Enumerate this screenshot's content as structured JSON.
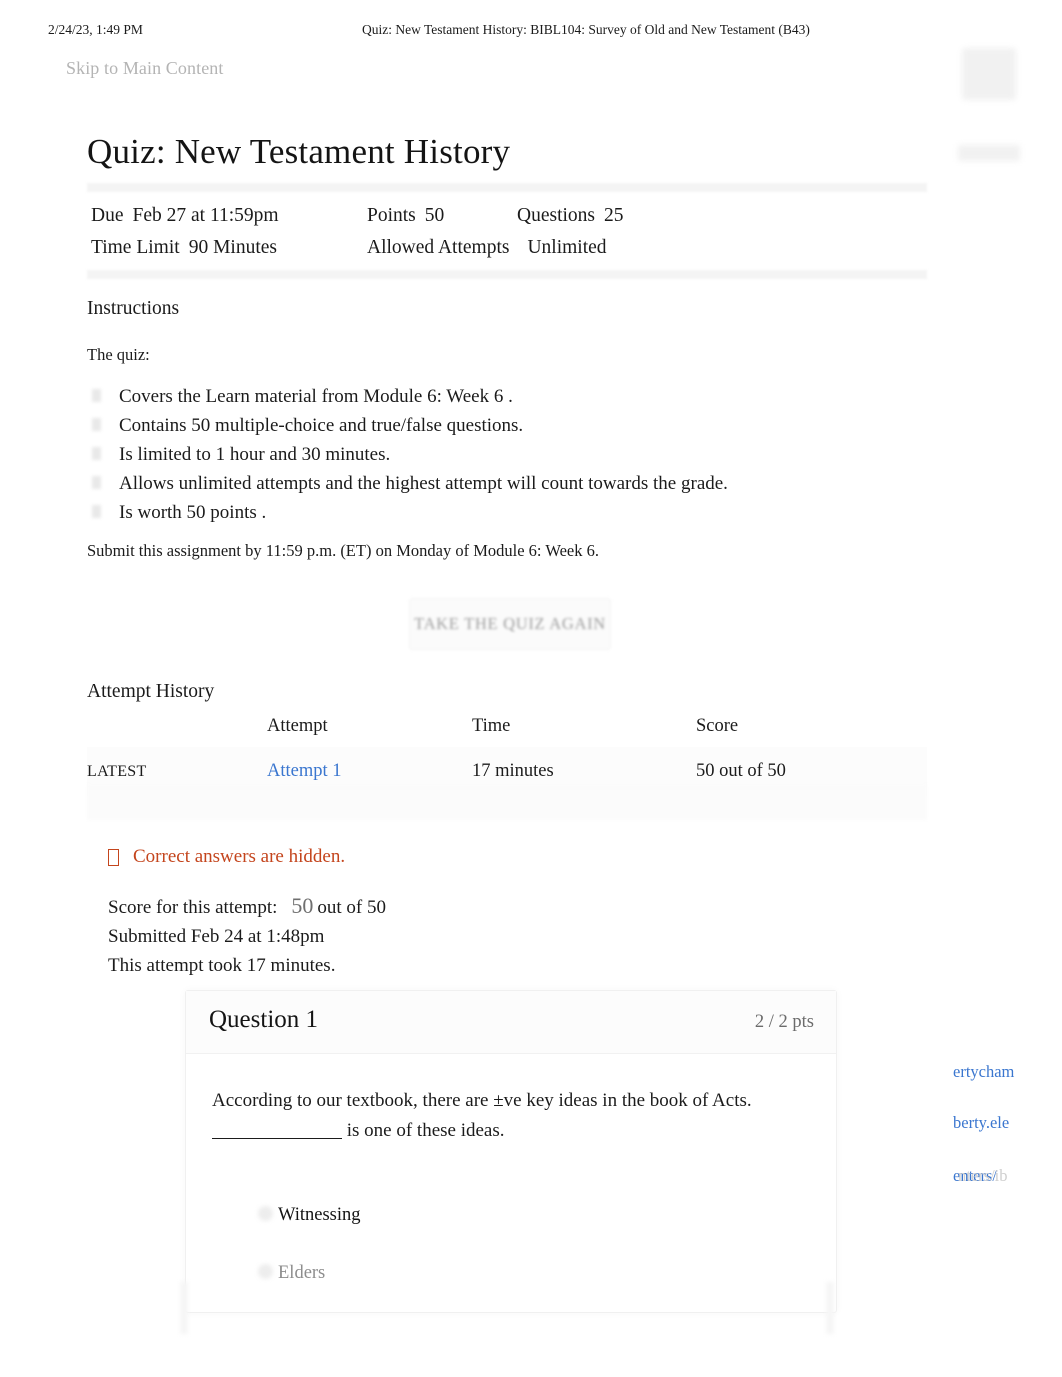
{
  "print_header": {
    "date": "2/24/23, 1:49 PM",
    "title": "Quiz: New Testament History: BIBL104: Survey of Old and New Testament (B43)"
  },
  "skip_link": "Skip to Main Content",
  "page_title": "Quiz: New Testament History",
  "quiz_details": {
    "due_label": "Due",
    "due_value": "Feb 27 at 11:59pm",
    "points_label": "Points",
    "points_value": "50",
    "questions_label": "Questions",
    "questions_value": "25",
    "time_limit_label": "Time Limit",
    "time_limit_value": "90 Minutes",
    "allowed_attempts_label": "Allowed Attempts",
    "allowed_attempts_value": "Unlimited"
  },
  "instructions": {
    "heading": "Instructions",
    "intro": "The quiz:",
    "bullets": [
      "Covers the  Learn  material from   Module 6: Week 6   .",
      "Contains  50 multiple-choice and true/false        questions.",
      "Is limited  to 1 hour and 30 minutes.",
      "Allows unlimited attempts     and the   highest   attempt will count towards the grade.",
      "Is worth 50 points   ."
    ],
    "submit_note": "Submit this assignment by 11:59 p.m. (ET) on Monday of Module 6: Week 6."
  },
  "take_quiz_button": "TAKE THE QUIZ AGAIN",
  "attempt_history": {
    "heading": "Attempt History",
    "columns": [
      "",
      "Attempt",
      "Time",
      "Score"
    ],
    "rows": [
      {
        "kept": "LATEST",
        "attempt": "Attempt 1",
        "time": "17 minutes",
        "score": "50 out of 50"
      }
    ]
  },
  "hidden_notice": "Correct answers are hidden.",
  "attempt_summary": {
    "score_label": "Score for this attempt:",
    "score_value": "50",
    "score_suffix": "out of 50",
    "submitted": "Submitted Feb 24 at 1:48pm",
    "duration": "This attempt took 17 minutes."
  },
  "question": {
    "title": "Question 1",
    "points": "2 / 2 pts",
    "text_before_blank": "According to our textbook, there are ±ve key ideas in the book of Acts.",
    "text_after_blank": " is one of these ideas.",
    "answers": [
      {
        "label": "Witnessing",
        "state": "selected"
      },
      {
        "label": "Elders",
        "state": "dim"
      }
    ]
  },
  "edge_fragments": {
    "frag1": "ertycham",
    "frag2": "berty.ele",
    "frag3": "enters/",
    "frag3b": "nters/ib"
  },
  "colors": {
    "link_blue": "#3a76cf",
    "notice_red": "#c4451d",
    "muted_gray": "#8d8d8d",
    "text": "#1b1b1b"
  }
}
